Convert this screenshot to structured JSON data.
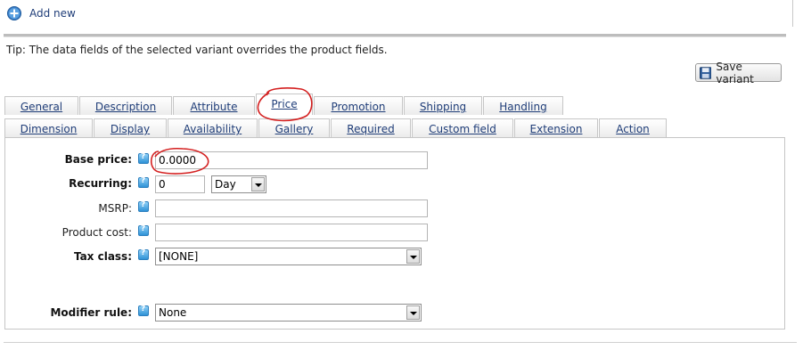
{
  "toolbar": {
    "add_new_label": "Add new",
    "save_variant_label": "Save variant"
  },
  "tip": "Tip: The data fields of the selected variant overrides the product fields.",
  "tabs_row1": [
    "General",
    "Description",
    "Attribute",
    "Price",
    "Promotion",
    "Shipping",
    "Handling"
  ],
  "tabs_row2": [
    "Dimension",
    "Display",
    "Availability",
    "Gallery",
    "Required",
    "Custom field",
    "Extension",
    "Action"
  ],
  "active_tab": "Price",
  "form": {
    "base_price": {
      "label": "Base price:",
      "value": "0.0000"
    },
    "recurring": {
      "label": "Recurring:",
      "value": "0",
      "unit": "Day"
    },
    "msrp": {
      "label": "MSRP:",
      "value": ""
    },
    "product_cost": {
      "label": "Product cost:",
      "value": ""
    },
    "tax_class": {
      "label": "Tax class:",
      "value": "[NONE]"
    },
    "modifier_rule": {
      "label": "Modifier rule:",
      "value": "None"
    }
  },
  "colors": {
    "link": "#1f3d78",
    "annotation": "#d42020",
    "tab_border": "#c6c6c6"
  },
  "icons": [
    "add-circle-icon",
    "floppy-disk-icon",
    "help-icon",
    "dropdown-arrow-icon"
  ]
}
